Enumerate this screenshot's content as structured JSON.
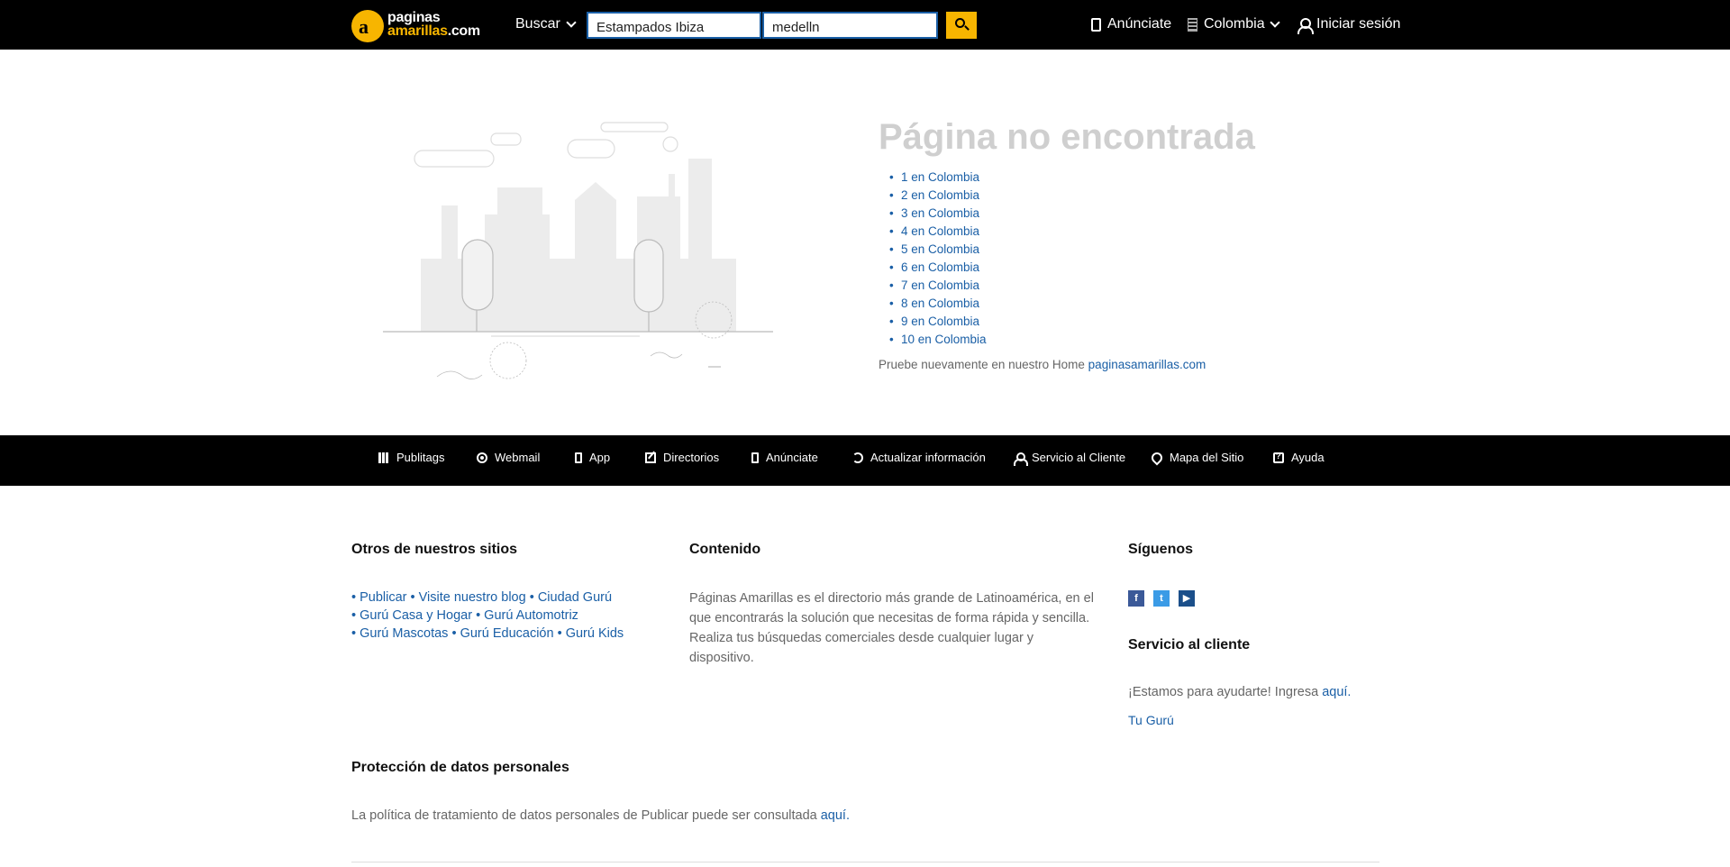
{
  "header": {
    "logo_line1": "paginas",
    "logo_line2": "amarillas",
    "logo_suffix": ".com",
    "search_menu_label": "Buscar",
    "query_value": "Estampados Ibiza",
    "location_value": "medelln",
    "advertise_label": "Anúnciate",
    "country_label": "Colombia",
    "login_label": "Iniciar sesión"
  },
  "not_found": {
    "title": "Página no encontrada",
    "links": [
      "1 en Colombia",
      "2 en Colombia",
      "3 en Colombia",
      "4 en Colombia",
      "5 en Colombia",
      "6 en Colombia",
      "7 en Colombia",
      "8 en Colombia",
      "9 en Colombia",
      "10 en Colombia"
    ],
    "retry_text": "Pruebe nuevamente en nuestro Home",
    "home_link": "paginasamarillas.com"
  },
  "footer_nav": [
    {
      "label": "Publitags",
      "icon": "grid-icon"
    },
    {
      "label": "Webmail",
      "icon": "at-icon"
    },
    {
      "label": "App",
      "icon": "phone-icon"
    },
    {
      "label": "Directorios",
      "icon": "edit-icon"
    },
    {
      "label": "Anúnciate",
      "icon": "phone-icon"
    },
    {
      "label": "Actualizar información",
      "icon": "refresh-icon"
    },
    {
      "label": "Servicio al Cliente",
      "icon": "person-icon"
    },
    {
      "label": "Mapa del Sitio",
      "icon": "map-icon"
    },
    {
      "label": "Ayuda",
      "icon": "help-icon"
    }
  ],
  "footer": {
    "other_sites_title": "Otros de nuestros sitios",
    "other_sites_rows": [
      [
        "Publicar",
        "Visite nuestro blog",
        "Ciudad Gurú"
      ],
      [
        "Gurú Casa y Hogar",
        "Gurú Automotriz"
      ],
      [
        "Gurú Mascotas",
        "Gurú Educación",
        "Gurú Kids"
      ]
    ],
    "content_title": "Contenido",
    "content_text": "Páginas Amarillas es el directorio más grande de Latinoamérica, en el que encontrarás la solución que necesitas de forma rápida y sencilla. Realiza tus búsquedas comerciales desde cualquier lugar y dispositivo.",
    "follow_title": "Síguenos",
    "social": [
      "f",
      "t",
      "▶"
    ],
    "customer_service_title": "Servicio al cliente",
    "customer_service_text": "¡Estamos para ayudarte! Ingresa",
    "customer_service_link": "aquí.",
    "guru_link": "Tu Gurú",
    "privacy_title": "Protección de datos personales",
    "privacy_text": "La política de tratamiento de datos personales de Publicar puede ser consultada",
    "privacy_link": "aquí."
  },
  "colors": {
    "brand_yellow": "#f7b500",
    "link_blue": "#1a5fa6",
    "header_bg": "#000000"
  }
}
